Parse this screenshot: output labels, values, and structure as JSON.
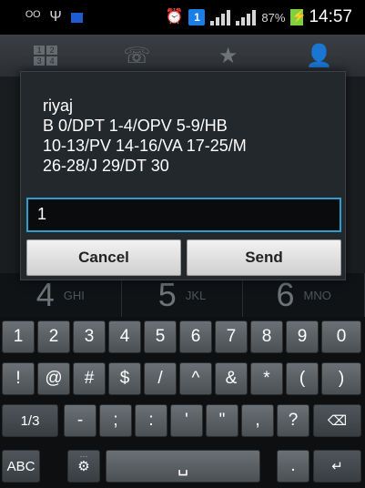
{
  "status_bar": {
    "battery_percent": "87%",
    "time": "14:57",
    "notification_count": "1",
    "icons": [
      "voicemail-icon",
      "usb-icon",
      "notification-icon",
      "alarm-icon",
      "signal-icon",
      "battery-charging-icon"
    ]
  },
  "tabs": [
    {
      "name": "keypad",
      "icon": "keypad-icon",
      "glyph_rows": [
        "1 2",
        "3 4"
      ]
    },
    {
      "name": "call-log",
      "icon": "call-log-icon",
      "glyph": "☏"
    },
    {
      "name": "favorites",
      "icon": "star-icon",
      "glyph": "★"
    },
    {
      "name": "contacts",
      "icon": "person-icon",
      "glyph": "👤"
    }
  ],
  "dialer_keys_visible": [
    {
      "num": "4",
      "letters": "GHI"
    },
    {
      "num": "5",
      "letters": "JKL"
    },
    {
      "num": "6",
      "letters": "MNO"
    }
  ],
  "dialog": {
    "message_lines": [
      "riyaj",
      "B 0/DPT 1-4/OPV 5-9/HB",
      "10-13/PV 14-16/VA 17-25/M",
      "26-28/J 29/DT 30"
    ],
    "input_value": "1",
    "cancel_label": "Cancel",
    "send_label": "Send"
  },
  "keyboard": {
    "row1": [
      "1",
      "2",
      "3",
      "4",
      "5",
      "6",
      "7",
      "8",
      "9",
      "0"
    ],
    "row2": [
      "!",
      "@",
      "#",
      "$",
      "/",
      "^",
      "&",
      "*",
      "(",
      ")"
    ],
    "row3": [
      "1/3",
      "-",
      ";",
      ":",
      "'",
      "\"",
      ",",
      "?",
      "⌫"
    ],
    "row4": {
      "abc": "ABC",
      "settings": "⚙",
      "space": "␣",
      "period": ".",
      "enter": "↵",
      "dots": "···"
    }
  }
}
